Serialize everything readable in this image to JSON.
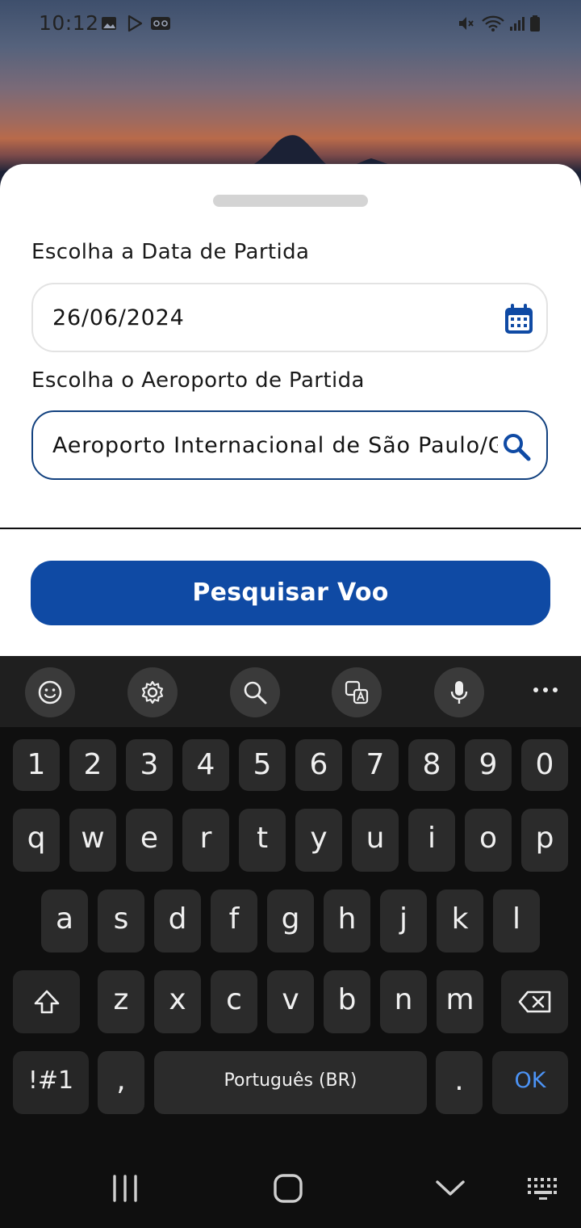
{
  "status_bar": {
    "time": "10:12",
    "left_icons": [
      "image-icon",
      "play-store-icon",
      "voicemail-icon"
    ],
    "right_icons": [
      "mute-icon",
      "wifi-icon",
      "signal-icon",
      "battery-icon"
    ]
  },
  "form": {
    "date_label": "Escolha a Data de Partida",
    "date_value": "26/06/2024",
    "airport_label": "Escolha o Aeroporto de Partida",
    "airport_value": "Aeroporto Internacional de São Paulo/Guarulhos",
    "search_button": "Pesquisar Voo"
  },
  "keyboard": {
    "toolbar_icons": [
      "emoji-icon",
      "settings-icon",
      "search-icon",
      "translate-icon",
      "microphone-icon",
      "more-icon"
    ],
    "number_row": [
      "1",
      "2",
      "3",
      "4",
      "5",
      "6",
      "7",
      "8",
      "9",
      "0"
    ],
    "row1": [
      "q",
      "w",
      "e",
      "r",
      "t",
      "y",
      "u",
      "i",
      "o",
      "p"
    ],
    "row2": [
      "a",
      "s",
      "d",
      "f",
      "g",
      "h",
      "j",
      "k",
      "l"
    ],
    "row3": [
      "z",
      "x",
      "c",
      "v",
      "b",
      "n",
      "m"
    ],
    "symbols": "!#1",
    "comma": ",",
    "space": "Português (BR)",
    "period": ".",
    "ok": "OK"
  },
  "colors": {
    "primary": "#0f4aa4",
    "field_border_active": "#12417f",
    "ok_text": "#4c93f5"
  }
}
